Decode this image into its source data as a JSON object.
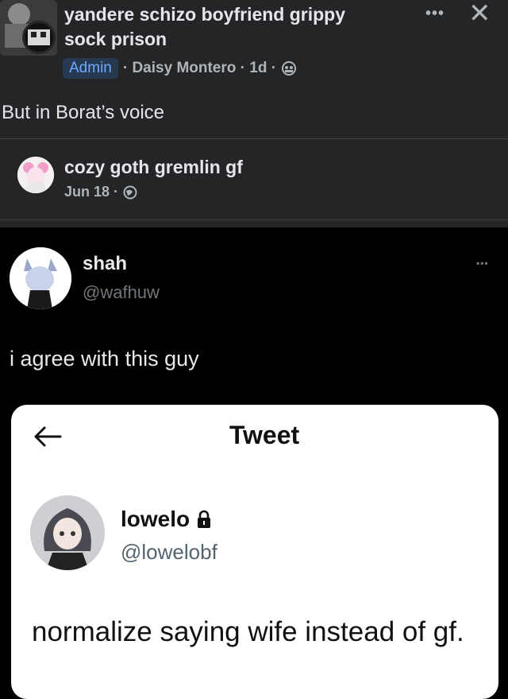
{
  "facebook_post": {
    "group_title_line1": "yandere schizo boyfriend grippy",
    "group_title_line2": "sock prison",
    "admin_badge": "Admin",
    "meta_text": "· Daisy Montero · 1d ·",
    "menu": "•••",
    "close": "✕",
    "post_text": "But in Borat’s voice",
    "shared": {
      "name": "cozy goth gremlin gf",
      "date": "Jun 18 ·"
    }
  },
  "tweet": {
    "name": "shah",
    "handle": "@wafhuw",
    "menu": "•••",
    "text": "i agree with this guy",
    "screenshot": {
      "title": "Tweet",
      "name": "lowelo",
      "handle": "@lowelobf",
      "text": "normalize saying wife instead of gf."
    }
  },
  "icons": [
    "group-avatar",
    "privacy-group-icon",
    "globe-icon",
    "lock-icon",
    "back-arrow-icon",
    "more-icon",
    "close-icon"
  ],
  "colors": {
    "facebook_bg": "#242526",
    "twitter_bg": "#000000",
    "admin_badge_bg": "#263951",
    "admin_badge_text": "#6fa8ff"
  }
}
